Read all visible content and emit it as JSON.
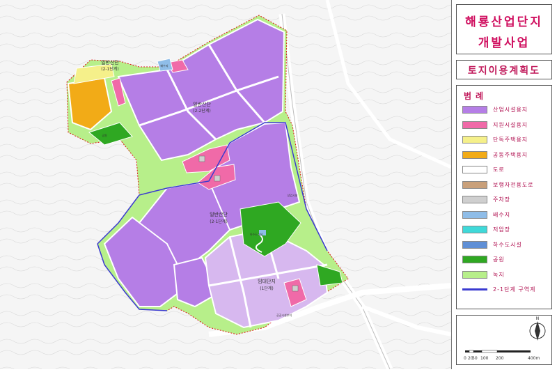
{
  "title": {
    "line1": "해룡산업단지",
    "line2": "개발사업"
  },
  "subtitle": "토지이용계획도",
  "legend": {
    "title": "범례",
    "items": [
      {
        "label": "산업시설용지",
        "color": "#b57ee6"
      },
      {
        "label": "지원시설용지",
        "color": "#f06aa8"
      },
      {
        "label": "단독주택용지",
        "color": "#f5f08a"
      },
      {
        "label": "공동주택용지",
        "color": "#f2ab17"
      },
      {
        "label": "도로",
        "color": "#ffffff"
      },
      {
        "label": "보행자전용도로",
        "color": "#c9a07a"
      },
      {
        "label": "주차장",
        "color": "#cfcfcf"
      },
      {
        "label": "배수지",
        "color": "#8fbde8"
      },
      {
        "label": "저압장",
        "color": "#3fd9d9"
      },
      {
        "label": "하수도시설",
        "color": "#5f8fd6"
      },
      {
        "label": "공원",
        "color": "#2fa822"
      },
      {
        "label": "녹지",
        "color": "#b7ef8a"
      },
      {
        "label": "2-1단계 구역계",
        "color": "#3a3ad0"
      }
    ]
  },
  "map_labels": {
    "industry_a": "일반산단",
    "industry_a_stage": "(2-1단계)",
    "industry_b": "일반산단",
    "industry_b_stage": "(2-2단계)",
    "industry_c": "일반산단",
    "industry_c_stage": "(2-1단계)",
    "rental": "임대단지",
    "rental_stage": "(1단계)",
    "water": "배수지",
    "park": "공원",
    "facility": "하수도시설",
    "roadside": "상업시설",
    "south_note": "공공시설부지"
  },
  "scale": {
    "labels": [
      "0",
      "20",
      "50",
      "100",
      "200",
      "400m"
    ]
  },
  "north_symbol": "N"
}
